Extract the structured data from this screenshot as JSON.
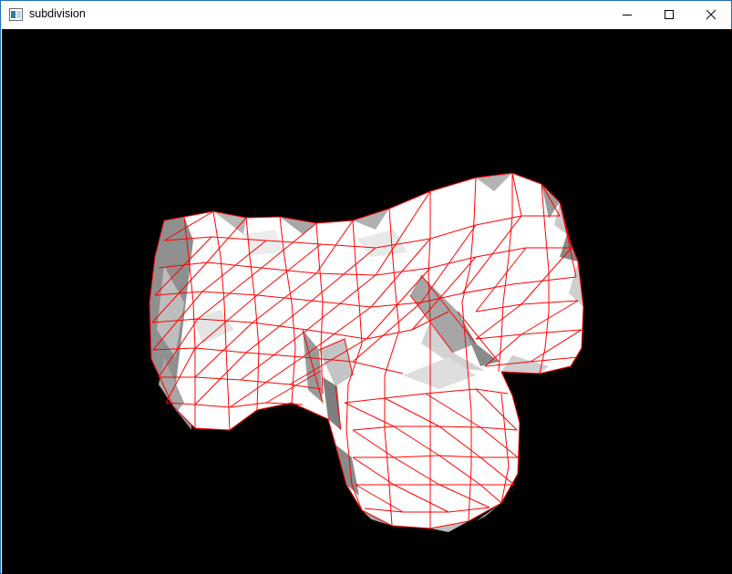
{
  "window": {
    "title": "subdivision",
    "controls": {
      "minimize": "minimize-icon",
      "maximize": "maximize-icon",
      "close": "close-icon"
    }
  },
  "viewport": {
    "background": "#000000",
    "mesh": {
      "fill_color": "#ffffff",
      "shade_color": "#9a9a9a",
      "edge_color": "#ff0000"
    }
  }
}
